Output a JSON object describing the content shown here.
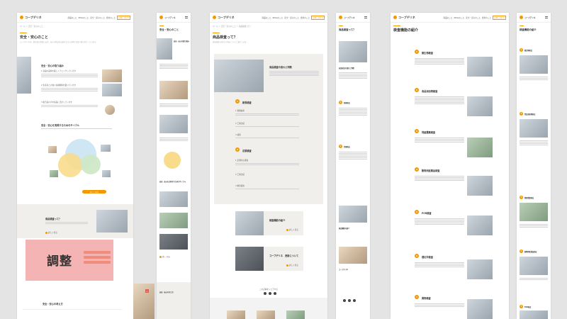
{
  "site": {
    "logo": "コープデリネ",
    "nav": [
      "商品のこと",
      "SDGsのこと",
      "安全・安心のこと",
      "会社のこと",
      "採用のこと"
    ],
    "cta": "お問い合わせ"
  },
  "page1": {
    "breadcrumb": "ホーム ＞ 安全・安心のこと",
    "title": "安全・安心のこと",
    "subtitle": "コープデリネは、組合員の皆様に安全・安心な商品をお届けするため様々な取り組みを行っています。",
    "section1": "安全・安心の取り組み",
    "points": [
      "1 商品の品質を厳しくチェックしています",
      "2 生産者との強い信頼関係を築いています",
      "3 組合員の声を商品に活かしています"
    ],
    "section2": "安全・安心を実現するためのサイクル",
    "cycle_button": "詳しく見る",
    "card_title": "商品検査って？",
    "card_more": "詳しく見る",
    "banner_text": "調整",
    "section3": "安全・安心の考え方"
  },
  "page2": {
    "breadcrumb": "ホーム ＞ 安全・安心",
    "title": "安全・安心のこと",
    "section1": "安全・安心の取り組み",
    "section2": "安全・安心を実現するためのサイクル",
    "bottom": "安全・安心の考え方"
  },
  "page3": {
    "breadcrumb": "ホーム ＞ 安全・安心のこと ＞ 商品検査って？",
    "title": "商品検査って？",
    "subtitle": "商品検査の流れと内容についてご紹介します。",
    "intro_title": "商品検査の流れと判断",
    "steps": [
      {
        "num": "1",
        "title": "新規検査",
        "sub": [
          "1 書類審査",
          "2 工場点検",
          "3 検査"
        ]
      },
      {
        "num": "2",
        "title": "定期検査",
        "sub": [
          "1 定期的な検査",
          "2 工場点検",
          "3 精密検査"
        ]
      }
    ],
    "cards": [
      {
        "title": "検査機能の紹介",
        "more": "詳しく見る"
      },
      {
        "title": "コープデリネ　更新について",
        "more": "詳しく見る"
      }
    ],
    "footer_label": "この記事をシェアする"
  },
  "page4": {
    "title": "商品検査って？",
    "intro_title": "商品検査の流れと判断",
    "steps": [
      "新規検査",
      "定期検査"
    ],
    "cards": [
      "検査機能の紹介",
      "コープデリネ"
    ]
  },
  "page5": {
    "title": "検査機能の紹介",
    "items": [
      {
        "num": "1",
        "title": "微生物検査"
      },
      {
        "num": "2",
        "title": "食品添加物検査"
      },
      {
        "num": "3",
        "title": "残留農薬検査"
      },
      {
        "num": "4",
        "title": "動物用医薬品検査"
      },
      {
        "num": "5",
        "title": "PCR検査"
      },
      {
        "num": "6",
        "title": "理化学検査"
      },
      {
        "num": "7",
        "title": "異物検査"
      }
    ],
    "more": "詳しく見る"
  },
  "page6": {
    "title": "検査機能の紹介",
    "items": [
      "微生物検査",
      "食品添加物検査",
      "残留農薬検査",
      "動物用医薬品検査",
      "PCR検査"
    ]
  },
  "colors": {
    "accent": "#f39800",
    "red": "#e85a4f",
    "pink": "#f5b4b4"
  }
}
